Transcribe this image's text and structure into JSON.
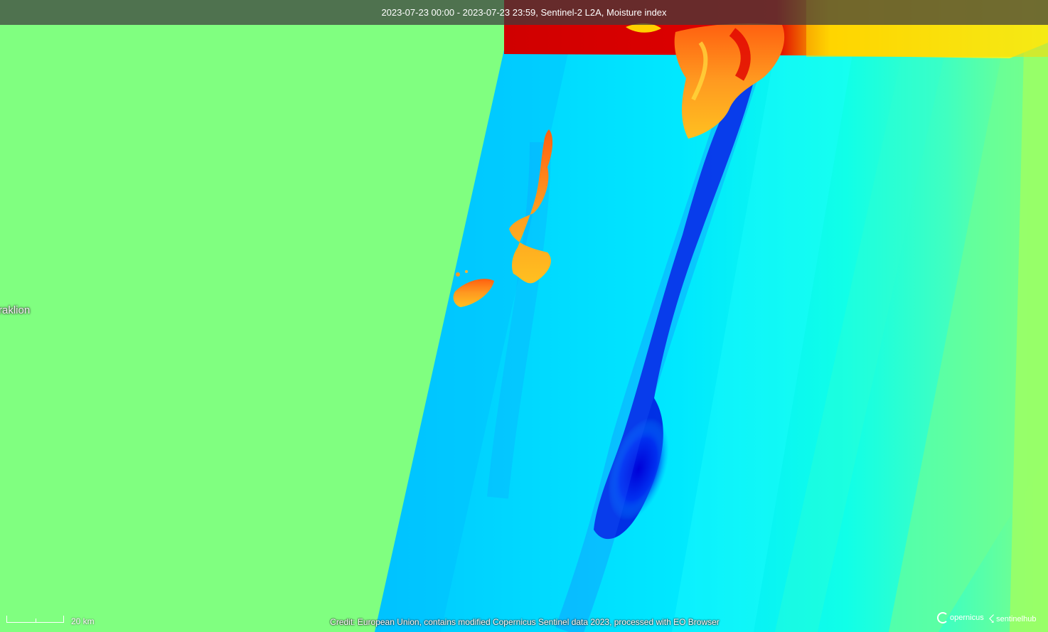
{
  "header": {
    "title": "2023-07-23 00:00 - 2023-07-23 23:59, Sentinel-2 L2A, Moisture index"
  },
  "map": {
    "place_label": "Heraklion",
    "place_label_visible": "raklion",
    "colors": {
      "background": "#80ff80",
      "sea": "#00d0ff",
      "sea_light": "#40ffe8",
      "plume": "#0010e0",
      "land_orange": "#ff8a1a",
      "land_red": "#e00000",
      "land_yellow": "#ffe000",
      "strip_green": "#a0ff60"
    }
  },
  "scale": {
    "label": "20 km"
  },
  "footer": {
    "credit": "Credit: European Union, contains modified Copernicus Sentinel data 2023, processed with EO Browser",
    "logo_copernicus": "opernicus",
    "logo_sentinelhub": "sentinelhub",
    "copernicus_icon": "copernicus-ring-icon",
    "sentinelhub_icon": "sentinelhub-bolt-icon"
  }
}
